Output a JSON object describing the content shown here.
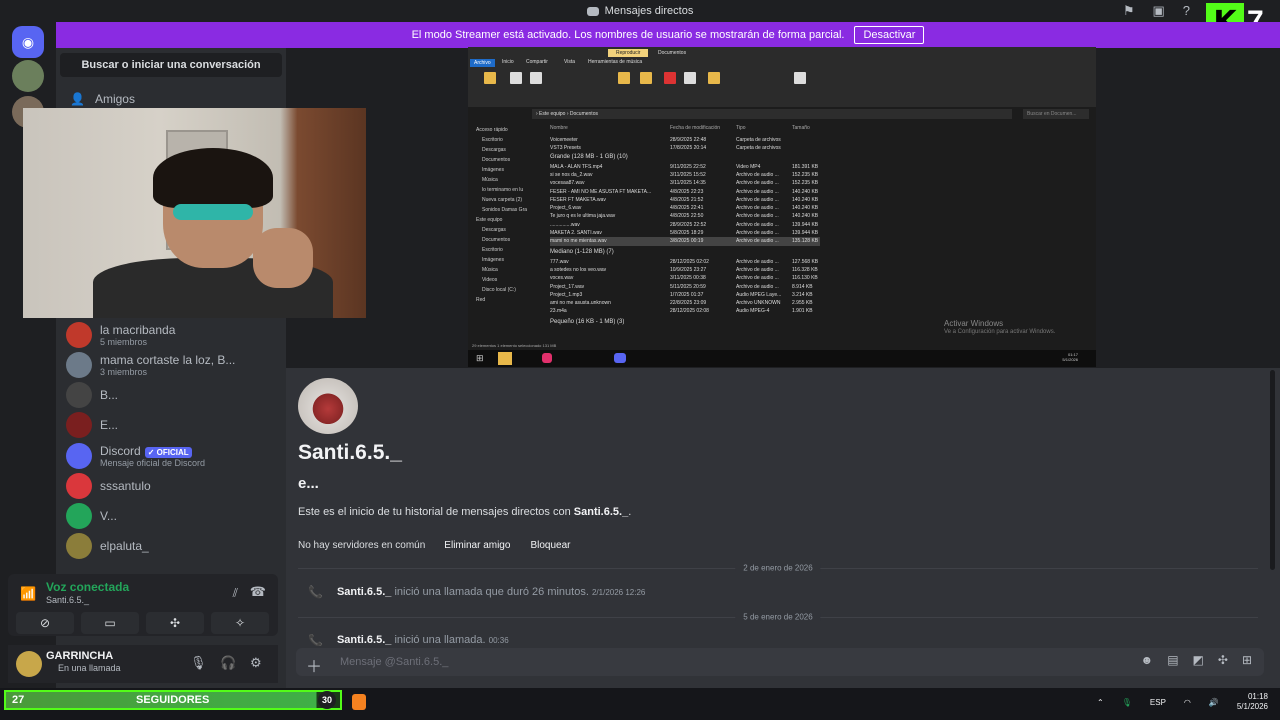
{
  "window": {
    "title": "Mensajes directos"
  },
  "banner": {
    "text": "El modo Streamer está activado. Los nombres de usuario se mostrarán de forma parcial.",
    "button": "Desactivar"
  },
  "overlay": {
    "kick_letter": "K",
    "kick_count": "7",
    "followers_current": "27",
    "followers_label": "SEGUIDORES",
    "followers_goal": "30"
  },
  "sidebar": {
    "search": "Buscar o iniciar una conversación",
    "friends": "Amigos",
    "dms": [
      {
        "name": "la macribanda",
        "sub": "5 miembros",
        "color": "#c0392b"
      },
      {
        "name": "mama cortaste la loz, B...",
        "sub": "3 miembros",
        "color": "#6c7a89"
      },
      {
        "name": "B...",
        "sub": "",
        "color": "#444444"
      },
      {
        "name": "E...",
        "sub": "",
        "color": "#7a1f1f"
      },
      {
        "name": "Discord",
        "sub": "Mensaje oficial de Discord",
        "color": "#5865f2",
        "badge": "✓ OFICIAL"
      },
      {
        "name": "sssantulo",
        "sub": "",
        "color": "#da373c"
      },
      {
        "name": "V...",
        "sub": "",
        "color": "#23a55a"
      },
      {
        "name": "elpaluta_",
        "sub": "",
        "color": "#8b7d3a"
      }
    ],
    "voice": {
      "status": "Voz conectada",
      "channel": "Santi.6.5._"
    },
    "user": {
      "name": "GARRINCHA",
      "status": "En una llamada"
    }
  },
  "shared_screen": {
    "ribbon_tabs": [
      "Archivo",
      "Inicio",
      "Compartir",
      "Vista",
      "Herramientas de música"
    ],
    "ribbon_top": [
      "Reproducir",
      "Documentos"
    ],
    "address": "› Este equipo › Documentos",
    "search_placeholder": "Buscar en Documen...",
    "columns": [
      "Nombre",
      "Fecha de modificación",
      "Tipo",
      "Tamaño"
    ],
    "nav": [
      "Acceso rápido",
      "Escritorio",
      "Descargas",
      "Documentos",
      "Imágenes",
      "Música",
      "lo terminamo en lu",
      "Nueva carpeta (2)",
      "Sonidos Damas Gra",
      "Este equipo",
      "Descargas",
      "Documentos",
      "Escritorio",
      "Imágenes",
      "Música",
      "Videos",
      "Disco local (C:)",
      "Red"
    ],
    "groups": [
      "Grande (128 MB - 1 GB) (10)",
      "Mediano (1-128 MB) (7)",
      "Pequeño (16 KB - 1 MB) (3)"
    ],
    "top_files": [
      {
        "n": "Voicemeeter",
        "d": "28/9/2025 22:48",
        "t": "Carpeta de archivos",
        "s": ""
      },
      {
        "n": "VST3 Presets",
        "d": "17/8/2025 20:14",
        "t": "Carpeta de archivos",
        "s": ""
      }
    ],
    "large_files": [
      {
        "n": "MALA - ALAN TFS.mp4",
        "d": "9/11/2025 22:52",
        "t": "Video MP4",
        "s": "181.391 KB"
      },
      {
        "n": "si se nos da_2.wav",
        "d": "3/11/2025 15:52",
        "t": "Archivo de audio ...",
        "s": "152.235 KB"
      },
      {
        "n": "vocesaa87.wav",
        "d": "3/11/2025 14:35",
        "t": "Archivo de audio ...",
        "s": "152.235 KB"
      },
      {
        "n": "FESER - AMI NO ME ASUSTA FT MAKETA...",
        "d": "4/8/2025 22:23",
        "t": "Archivo de audio ...",
        "s": "140.240 KB"
      },
      {
        "n": "FESER FT MAKETA.wav",
        "d": "4/8/2025 21:52",
        "t": "Archivo de audio ...",
        "s": "140.240 KB"
      },
      {
        "n": "Project_6.wav",
        "d": "4/8/2025 22:41",
        "t": "Archivo de audio ...",
        "s": "140.240 KB"
      },
      {
        "n": "Te juro q es le ultima jaja.wav",
        "d": "4/8/2025 22:50",
        "t": "Archivo de audio ...",
        "s": "140.240 KB"
      },
      {
        "n": "...............wav",
        "d": "28/9/2025 22:52",
        "t": "Archivo de audio ...",
        "s": "139.944 KB"
      },
      {
        "n": "MAKETA 2. SANTI.wav",
        "d": "5/8/2025 18:29",
        "t": "Archivo de audio ...",
        "s": "139.944 KB"
      },
      {
        "n": "mami no me mientas.wav",
        "d": "3/8/2025 00:19",
        "t": "Archivo de audio ...",
        "s": "135.128 KB"
      }
    ],
    "medium_files": [
      {
        "n": "777.wav",
        "d": "28/12/2025 02:02",
        "t": "Archivo de audio ...",
        "s": "127.568 KB"
      },
      {
        "n": "a sotedes no los veo.wav",
        "d": "10/9/2025 23:27",
        "t": "Archivo de audio ...",
        "s": "116.328 KB"
      },
      {
        "n": "voces.wav",
        "d": "3/11/2025 00:38",
        "t": "Archivo de audio ...",
        "s": "116.130 KB"
      },
      {
        "n": "Project_17.wav",
        "d": "5/11/2025 20:59",
        "t": "Archivo de audio ...",
        "s": "8.914 KB"
      },
      {
        "n": "Project_1.mp3",
        "d": "1/7/2025 01:37",
        "t": "Audio MPEG Laye...",
        "s": "3.214 KB"
      },
      {
        "n": "ami no me asusta.unknown",
        "d": "22/8/2025 23:09",
        "t": "Archivo UNKNOWN",
        "s": "2.955 KB"
      },
      {
        "n": "23.m4a",
        "d": "28/12/2025 02:08",
        "t": "Audio MPEG-4",
        "s": "1.901 KB"
      }
    ],
    "status": "29 elementos   1 elemento seleccionado 131 MB",
    "watermark_title": "Activar Windows",
    "watermark_text": "Ve a Configuración para activar Windows.",
    "inner_time": "01:17",
    "inner_date": "5/1/2026"
  },
  "chat": {
    "title": "Santi.6.5._",
    "subtitle": "e...",
    "intro_prefix": "Este es el inicio de tu historial de mensajes directos con ",
    "intro_name": "Santi.6.5._",
    "intro_suffix": ".",
    "no_servers": "No hay servidores en común",
    "remove_friend": "Eliminar amigo",
    "block": "Bloquear",
    "date1": "2 de enero de 2026",
    "call1_user": "Santi.6.5._",
    "call1_text": "inició una llamada que duró 26 minutos.",
    "call1_time": "2/1/2026 12:26",
    "date2": "5 de enero de 2026",
    "call2_user": "Santi.6.5._",
    "call2_text": "inició una llamada.",
    "call2_time": "00:36",
    "input_placeholder": "Mensaje @Santi.6.5._"
  },
  "taskbar": {
    "lang": "ESP",
    "time": "01:18",
    "date": "5/1/2026"
  }
}
